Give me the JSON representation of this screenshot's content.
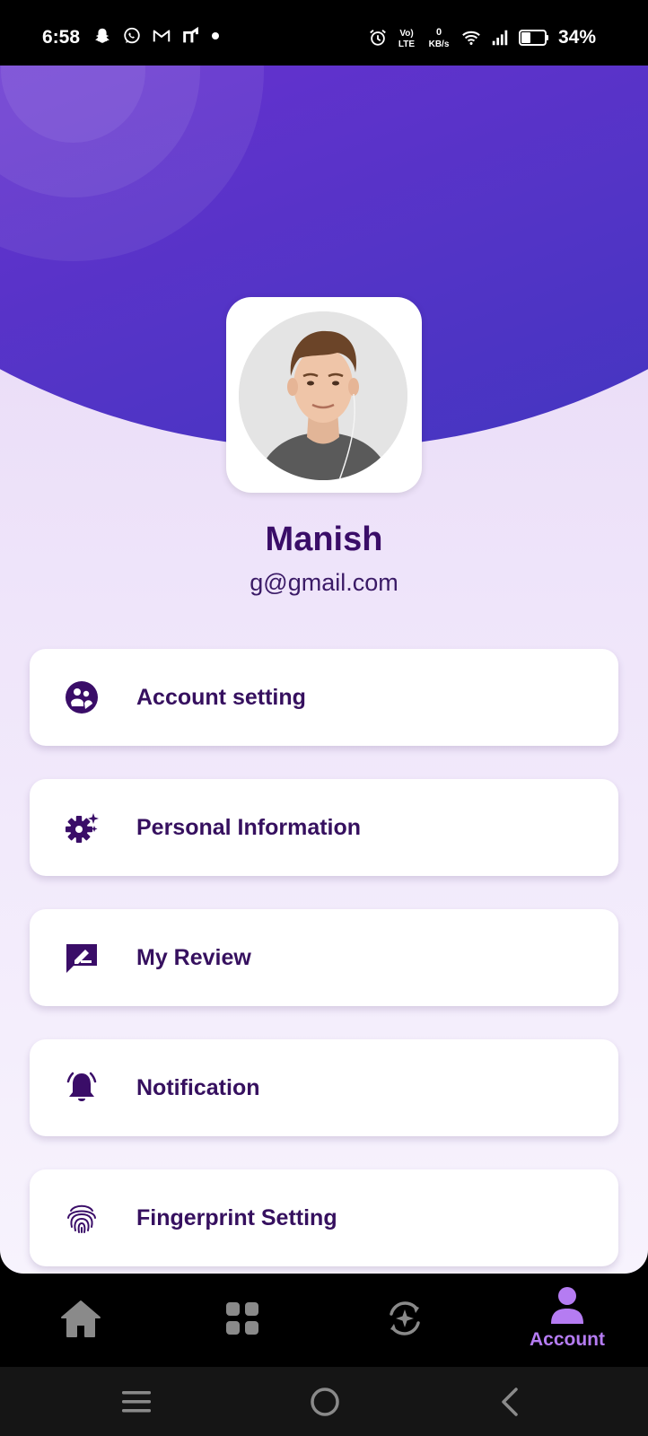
{
  "status_bar": {
    "time": "6:58",
    "net_speed_value": "0",
    "net_speed_unit": "KB/s",
    "volte_top": "Vo)",
    "volte_bottom": "LTE",
    "battery_percent": "34%"
  },
  "profile": {
    "name": "Manish",
    "email": "g@gmail.com"
  },
  "menu": [
    {
      "label": "Account setting",
      "icon": "account-group-icon"
    },
    {
      "label": "Personal Information",
      "icon": "gear-sparkle-icon"
    },
    {
      "label": "My Review",
      "icon": "review-edit-icon"
    },
    {
      "label": "Notification",
      "icon": "bell-icon"
    },
    {
      "label": "Fingerprint Setting",
      "icon": "fingerprint-icon"
    }
  ],
  "bottom_nav": {
    "items": [
      {
        "name": "home",
        "icon": "home-icon"
      },
      {
        "name": "grid",
        "icon": "grid-icon"
      },
      {
        "name": "refresh",
        "icon": "sparkle-refresh-icon"
      },
      {
        "name": "account",
        "icon": "person-icon",
        "label": "Account"
      }
    ],
    "active": "account"
  },
  "colors": {
    "accent": "#b57cf2",
    "primary_text": "#36105f",
    "header_gradient_start": "#8f52e0",
    "header_gradient_end": "#3d36be"
  }
}
